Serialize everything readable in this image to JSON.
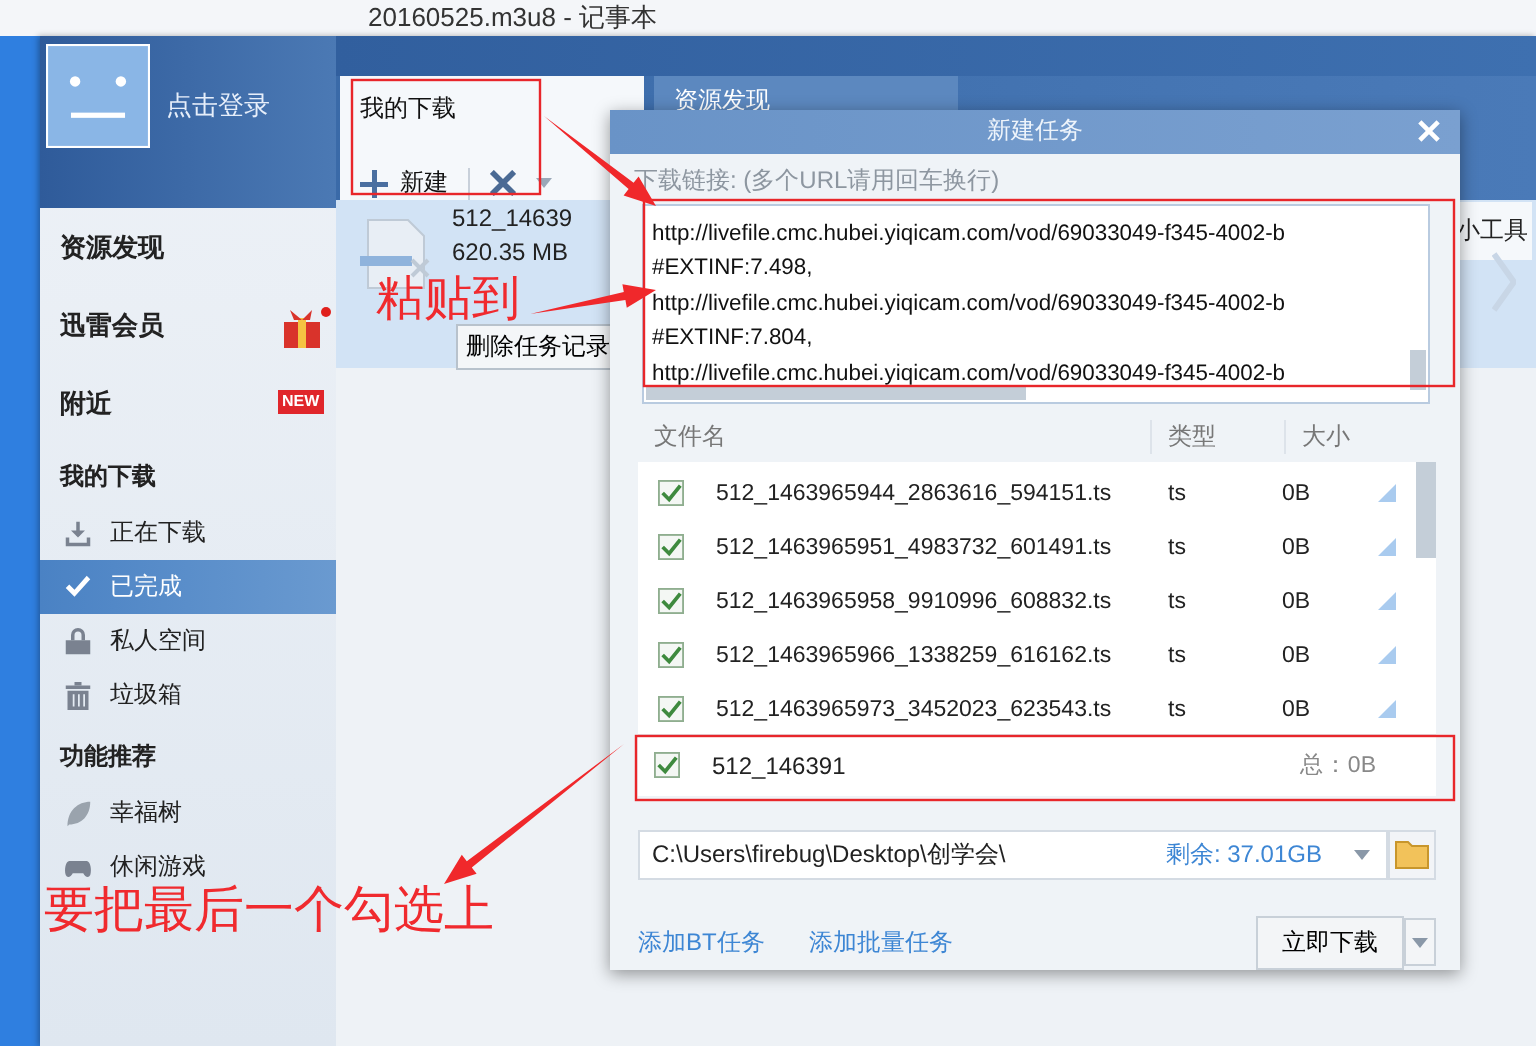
{
  "background_window": {
    "title": "20160525.m3u8 - 记事本"
  },
  "user": {
    "login": "点击登录"
  },
  "sidebar": {
    "items": [
      {
        "kind": "top",
        "label": "资源发现",
        "selected": false
      },
      {
        "kind": "top",
        "label": "迅雷会员",
        "selected": false
      },
      {
        "kind": "top",
        "label": "附近",
        "selected": false,
        "badge": "NEW"
      },
      {
        "kind": "section",
        "label": "我的下载"
      },
      {
        "kind": "sub",
        "label": "正在下载",
        "selected": false
      },
      {
        "kind": "sub",
        "label": "已完成",
        "selected": true
      },
      {
        "kind": "sub",
        "label": "私人空间",
        "selected": false
      },
      {
        "kind": "sub",
        "label": "垃圾箱",
        "selected": false
      },
      {
        "kind": "section",
        "label": "功能推荐"
      },
      {
        "kind": "sub",
        "label": "幸福树",
        "selected": false
      },
      {
        "kind": "sub",
        "label": "休闲游戏",
        "selected": false
      }
    ]
  },
  "tabs": [
    {
      "label": "我的下载",
      "selected": true
    },
    {
      "label": "资源发现",
      "selected": false
    }
  ],
  "toolbar": {
    "new": "新建",
    "tools": "小工具"
  },
  "task": {
    "name": "512_14639",
    "size": "620.35 MB",
    "action": "删除任务记录"
  },
  "dialog": {
    "title": "新建任务",
    "link_label": "下载链接: (多个URL请用回车换行)",
    "url_lines": [
      "http://livefile.cmc.hubei.yiqicam.com/vod/69033049-f345-4002-b",
      "#EXTINF:7.498,",
      "http://livefile.cmc.hubei.yiqicam.com/vod/69033049-f345-4002-b",
      "#EXTINF:7.804,",
      "http://livefile.cmc.hubei.yiqicam.com/vod/69033049-f345-4002-b"
    ],
    "columns": [
      "文件名",
      "类型",
      "大小"
    ],
    "files": [
      {
        "name": "512_1463965944_2863616_594151.ts",
        "type": "ts",
        "size": "0B",
        "checked": true
      },
      {
        "name": "512_1463965951_4983732_601491.ts",
        "type": "ts",
        "size": "0B",
        "checked": true
      },
      {
        "name": "512_1463965958_9910996_608832.ts",
        "type": "ts",
        "size": "0B",
        "checked": true
      },
      {
        "name": "512_1463965966_1338259_616162.ts",
        "type": "ts",
        "size": "0B",
        "checked": true
      },
      {
        "name": "512_1463965973_3452023_623543.ts",
        "type": "ts",
        "size": "0B",
        "checked": true
      }
    ],
    "total": {
      "name": "512_146391",
      "checked": true,
      "total": "总：0B"
    },
    "path": "C:\\Users\\firebug\\Desktop\\创学会\\",
    "free": "剩余: 37.01GB",
    "links": [
      "添加BT任务",
      "添加批量任务"
    ],
    "button": "立即下载"
  },
  "annotations": [
    {
      "text": "粘贴到"
    },
    {
      "text": "要把最后一个勾选上"
    }
  ]
}
